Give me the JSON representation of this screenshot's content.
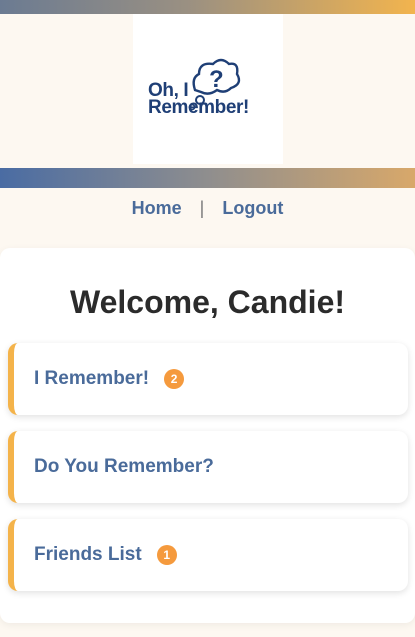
{
  "logo": {
    "line1": "Oh, I",
    "line2": "Remember!"
  },
  "nav": {
    "home": "Home",
    "separator": "|",
    "logout": "Logout"
  },
  "welcome": "Welcome, Candie!",
  "menu": [
    {
      "label": "I Remember!",
      "badge": "2"
    },
    {
      "label": "Do You Remember?",
      "badge": ""
    },
    {
      "label": "Friends List",
      "badge": "1"
    }
  ],
  "colors": {
    "accent": "#f4b34a",
    "badge": "#f59a3d",
    "link": "#4a6b9a",
    "brand": "#1f3f76"
  }
}
